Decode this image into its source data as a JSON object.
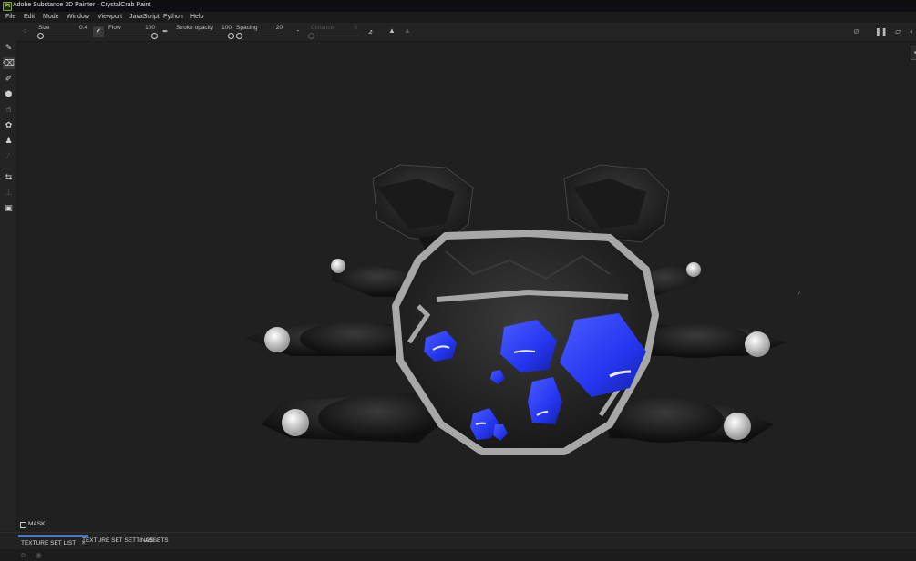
{
  "window": {
    "logo": "Pt",
    "title": "Adobe Substance 3D Painter - CrystalCrab Paint"
  },
  "menu": [
    "File",
    "Edit",
    "Mode",
    "Window",
    "Viewport",
    "JavaScript",
    "Python",
    "Help"
  ],
  "properties": {
    "size": {
      "label": "Size",
      "value": "0.4",
      "fraction": 0.04
    },
    "flow": {
      "label": "Flow",
      "value": "100",
      "fraction": 1.0
    },
    "stroke_opacity": {
      "label": "Stroke opacity",
      "value": "100",
      "fraction": 1.0
    },
    "spacing": {
      "label": "Spacing",
      "value": "20",
      "fraction": 0.0
    },
    "distance": {
      "label": "Distance",
      "value": "0",
      "fraction": 0.0,
      "disabled": true
    }
  },
  "left_tools": [
    {
      "name": "paint-brush-icon",
      "glyph": "✎",
      "active": false
    },
    {
      "name": "eraser-icon",
      "glyph": "⌫",
      "active": true
    },
    {
      "name": "projection-icon",
      "glyph": "✐",
      "active": false
    },
    {
      "name": "polygon-fill-icon",
      "glyph": "⬢",
      "active": false
    },
    {
      "name": "smudge-icon",
      "glyph": "☝",
      "active": false
    },
    {
      "name": "clone-icon",
      "glyph": "✿",
      "active": false
    },
    {
      "name": "stamp-icon",
      "glyph": "♟",
      "active": false
    },
    {
      "name": "color-picker-icon",
      "glyph": "⁄",
      "active": false,
      "dim": true
    },
    {
      "name": "bake-icon",
      "glyph": "⇆",
      "active": false
    },
    {
      "name": "measure-icon",
      "glyph": "⊥",
      "active": false,
      "dim": true
    },
    {
      "name": "render-icon",
      "glyph": "▣",
      "active": false
    }
  ],
  "viewport": {
    "mask_label": "MASK",
    "crystal_color": "#2a3bff",
    "shell_color": "#2b2b2b",
    "rim_color": "#a7a7a7"
  },
  "bottom_tabs": {
    "texture_set_list": "TEXTURE SET LIST",
    "close_glyph": "✕",
    "texture_set_settings": "TEXTURE SET SETTINGS",
    "assets": "ASSETS"
  }
}
